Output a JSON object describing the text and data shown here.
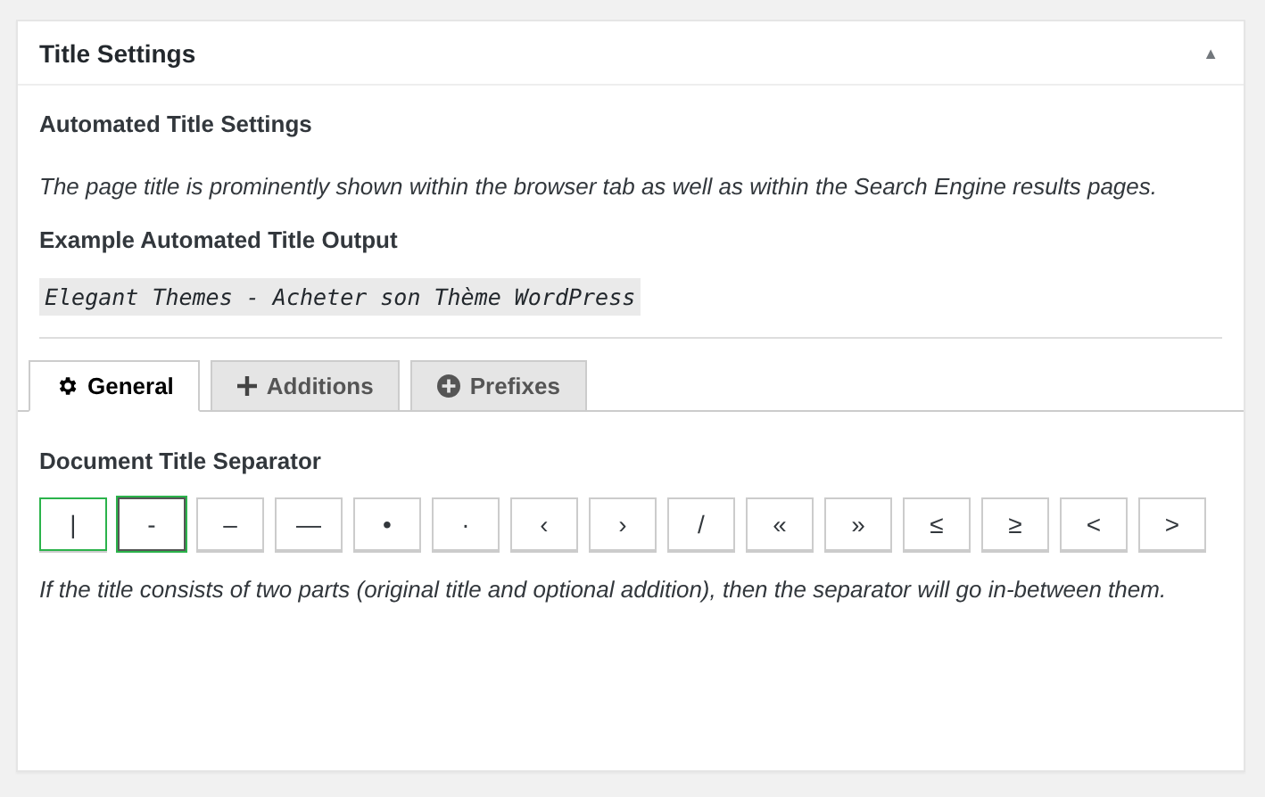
{
  "panel": {
    "title": "Title Settings",
    "collapse_glyph": "▲"
  },
  "section_heading": "Automated Title Settings",
  "description": "The page title is prominently shown within the browser tab as well as within the Search Engine results pages.",
  "example_heading": "Example Automated Title Output",
  "example_output": "Elegant Themes - Acheter son Thème WordPress",
  "tabs": [
    {
      "label": "General",
      "kind": "gear",
      "selected": true
    },
    {
      "label": "Additions",
      "kind": "plus",
      "selected": false
    },
    {
      "label": "Prefixes",
      "kind": "plus-circle",
      "selected": false
    }
  ],
  "separator_heading": "Document Title Separator",
  "separators": [
    {
      "label": "|",
      "selected": true,
      "focused": false
    },
    {
      "label": "-",
      "selected": false,
      "focused": true
    },
    {
      "label": "–",
      "selected": false,
      "focused": false
    },
    {
      "label": "—",
      "selected": false,
      "focused": false
    },
    {
      "label": "•",
      "selected": false,
      "focused": false
    },
    {
      "label": "·",
      "selected": false,
      "focused": false
    },
    {
      "label": "‹",
      "selected": false,
      "focused": false
    },
    {
      "label": "›",
      "selected": false,
      "focused": false
    },
    {
      "label": "/",
      "selected": false,
      "focused": false
    },
    {
      "label": "«",
      "selected": false,
      "focused": false
    },
    {
      "label": "»",
      "selected": false,
      "focused": false
    },
    {
      "label": "≤",
      "selected": false,
      "focused": false
    },
    {
      "label": "≥",
      "selected": false,
      "focused": false
    },
    {
      "label": "<",
      "selected": false,
      "focused": false
    },
    {
      "label": ">",
      "selected": false,
      "focused": false
    }
  ],
  "separator_help": "If the title consists of two parts (original title and optional addition), then the separator will go in-between them."
}
